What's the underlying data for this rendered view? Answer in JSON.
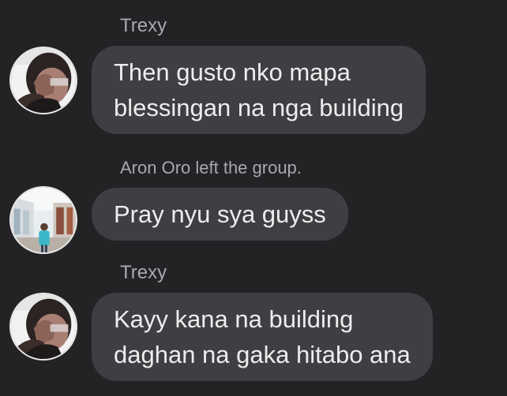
{
  "messages": [
    {
      "sender": "Trexy",
      "avatar_icon": "person-photo-avatar",
      "lines": [
        "Then gusto nko mapa",
        "blessingan na nga building"
      ]
    },
    {
      "system_notice": "Aron Oro left the group.",
      "avatar_icon": "person-photo-avatar-building",
      "lines": [
        "Pray nyu sya guyss"
      ]
    },
    {
      "sender": "Trexy",
      "avatar_icon": "person-photo-avatar",
      "lines": [
        "Kayy kana na building",
        "daghan na gaka hitabo ana"
      ]
    }
  ],
  "colors": {
    "background": "#232325",
    "bubble": "#3e3f42",
    "bubble_text": "#ededee",
    "meta_text": "#a7a9ad"
  }
}
